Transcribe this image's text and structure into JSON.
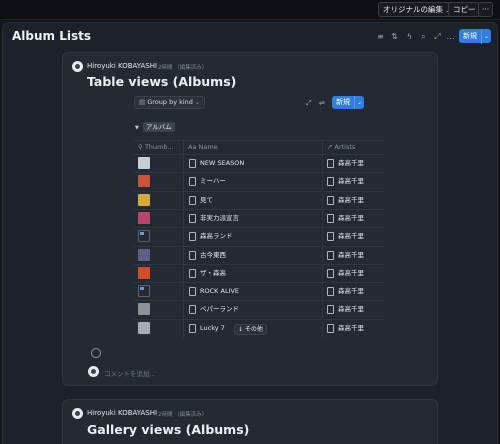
{
  "topbar": {
    "original_edit_label": "オリジナルの編集",
    "copy_label": "コピー",
    "more_label": "···"
  },
  "page": {
    "title": "Album Lists",
    "new_label": "新規"
  },
  "card1": {
    "author": "Hiroyuki KOBAYASHI",
    "meta": "2時間 （編集済み）",
    "db_title": "Table views (Albums)",
    "group_by_label": "Group by kind",
    "new_label": "新規",
    "group_name": "アルバム",
    "columns": {
      "thumb": "Thumb...",
      "name_prefix": "Aa",
      "name": "Name",
      "artists": "Artists"
    },
    "rows": [
      {
        "name": "NEW SEASON",
        "artist": "森高千里",
        "thumb_color": "#c9cdd4"
      },
      {
        "name": "ミーハー",
        "artist": "森高千里",
        "thumb_color": "#c9553a"
      },
      {
        "name": "見て",
        "artist": "森高千里",
        "thumb_color": "#d8a83a"
      },
      {
        "name": "非実力派宣言",
        "artist": "森高千里",
        "thumb_color": "#b8456a"
      },
      {
        "name": "森高ランド",
        "artist": "森高千里",
        "thumb_color": "broken"
      },
      {
        "name": "古今東西",
        "artist": "森高千里",
        "thumb_color": "#5c5f86"
      },
      {
        "name": "ザ・森高",
        "artist": "森高千里",
        "thumb_color": "#d04a2c"
      },
      {
        "name": "ROCK ALIVE",
        "artist": "森高千里",
        "thumb_color": "broken"
      },
      {
        "name": "ペパーランド",
        "artist": "森高千里",
        "thumb_color": "#8f9298"
      },
      {
        "name": "Lucky 7",
        "artist": "森高千里",
        "thumb_color": "#a8acb4"
      }
    ],
    "other_badge": "↓ その他",
    "comment_placeholder": "コメントを追加..."
  },
  "card2": {
    "author": "Hiroyuki KOBAYASHI",
    "meta": "2時間 （編集済み）",
    "db_title": "Gallery views (Albums)"
  },
  "colors": {
    "accent": "#2f7fe0",
    "page_bg": "#1c222b",
    "card_bg": "#232a34"
  },
  "icons": [
    "filter-icon",
    "sort-icon",
    "lightning-icon",
    "search-icon",
    "expand-icon",
    "settings-icon",
    "table-icon",
    "link-icon",
    "relation-icon",
    "doc-icon",
    "emoji-icon"
  ]
}
